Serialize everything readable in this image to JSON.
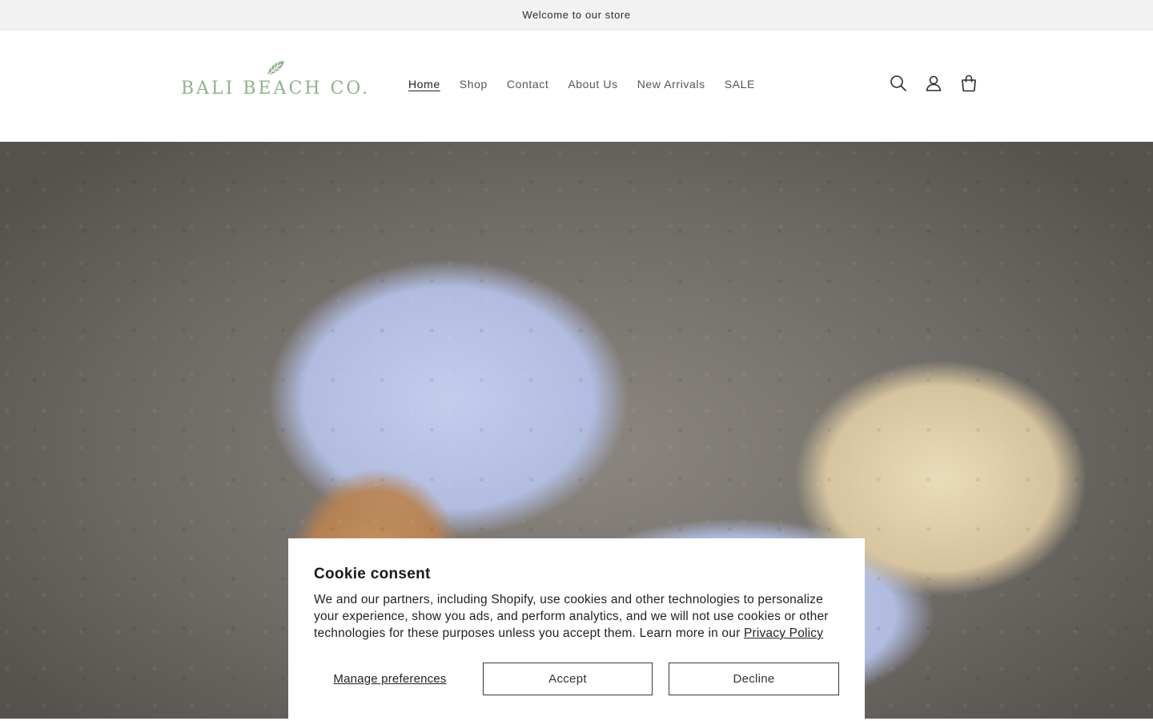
{
  "announcement": {
    "text": "Welcome to our store"
  },
  "header": {
    "logo_text": "BALI BEACH CO.",
    "brand_color": "#8db38a",
    "nav": [
      {
        "label": "Home",
        "active": true
      },
      {
        "label": "Shop",
        "active": false
      },
      {
        "label": "Contact",
        "active": false
      },
      {
        "label": "About Us",
        "active": false
      },
      {
        "label": "New Arrivals",
        "active": false
      },
      {
        "label": "SALE",
        "active": false
      }
    ],
    "icons": [
      "search-icon",
      "account-icon",
      "cart-icon"
    ]
  },
  "hero": {
    "image_description_icon": "hero-image"
  },
  "cookie": {
    "title": "Cookie consent",
    "body": "We and our partners, including Shopify, use cookies and other technologies to personalize your experience, show you ads, and perform analytics, and we will not use cookies or other technologies for these purposes unless you accept them. Learn more in our ",
    "privacy_link": "Privacy Policy",
    "manage_label": "Manage preferences",
    "accept_label": "Accept",
    "decline_label": "Decline"
  }
}
